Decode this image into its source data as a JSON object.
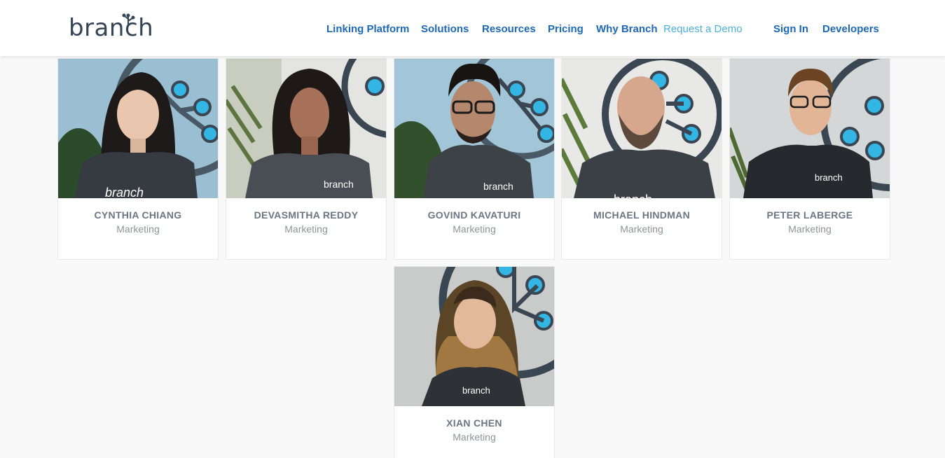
{
  "header": {
    "logo_text": "branch",
    "nav": [
      {
        "label": "Linking Platform"
      },
      {
        "label": "Solutions"
      },
      {
        "label": "Resources"
      },
      {
        "label": "Pricing"
      },
      {
        "label": "Why Branch"
      },
      {
        "label": "Request a Demo"
      },
      {
        "label": "Sign In"
      },
      {
        "label": "Developers"
      }
    ]
  },
  "colors": {
    "nav_link": "#1e68b5",
    "demo_link": "#4fb0e0",
    "logo": "#344454",
    "name_text": "#6b7683",
    "role_text": "#8d949c",
    "page_bg": "#f9f9f9"
  },
  "team": [
    {
      "name": "CYNTHIA CHIANG",
      "role": "Marketing",
      "shirt_text": "branch"
    },
    {
      "name": "DEVASMITHA REDDY",
      "role": "Marketing",
      "shirt_text": "branch"
    },
    {
      "name": "GOVIND KAVATURI",
      "role": "Marketing",
      "shirt_text": "branch"
    },
    {
      "name": "MICHAEL HINDMAN",
      "role": "Marketing",
      "shirt_text": "branch"
    },
    {
      "name": "PETER LABERGE",
      "role": "Marketing",
      "shirt_text": "branch"
    },
    {
      "name": "XIAN CHEN",
      "role": "Marketing",
      "shirt_text": "branch"
    }
  ]
}
